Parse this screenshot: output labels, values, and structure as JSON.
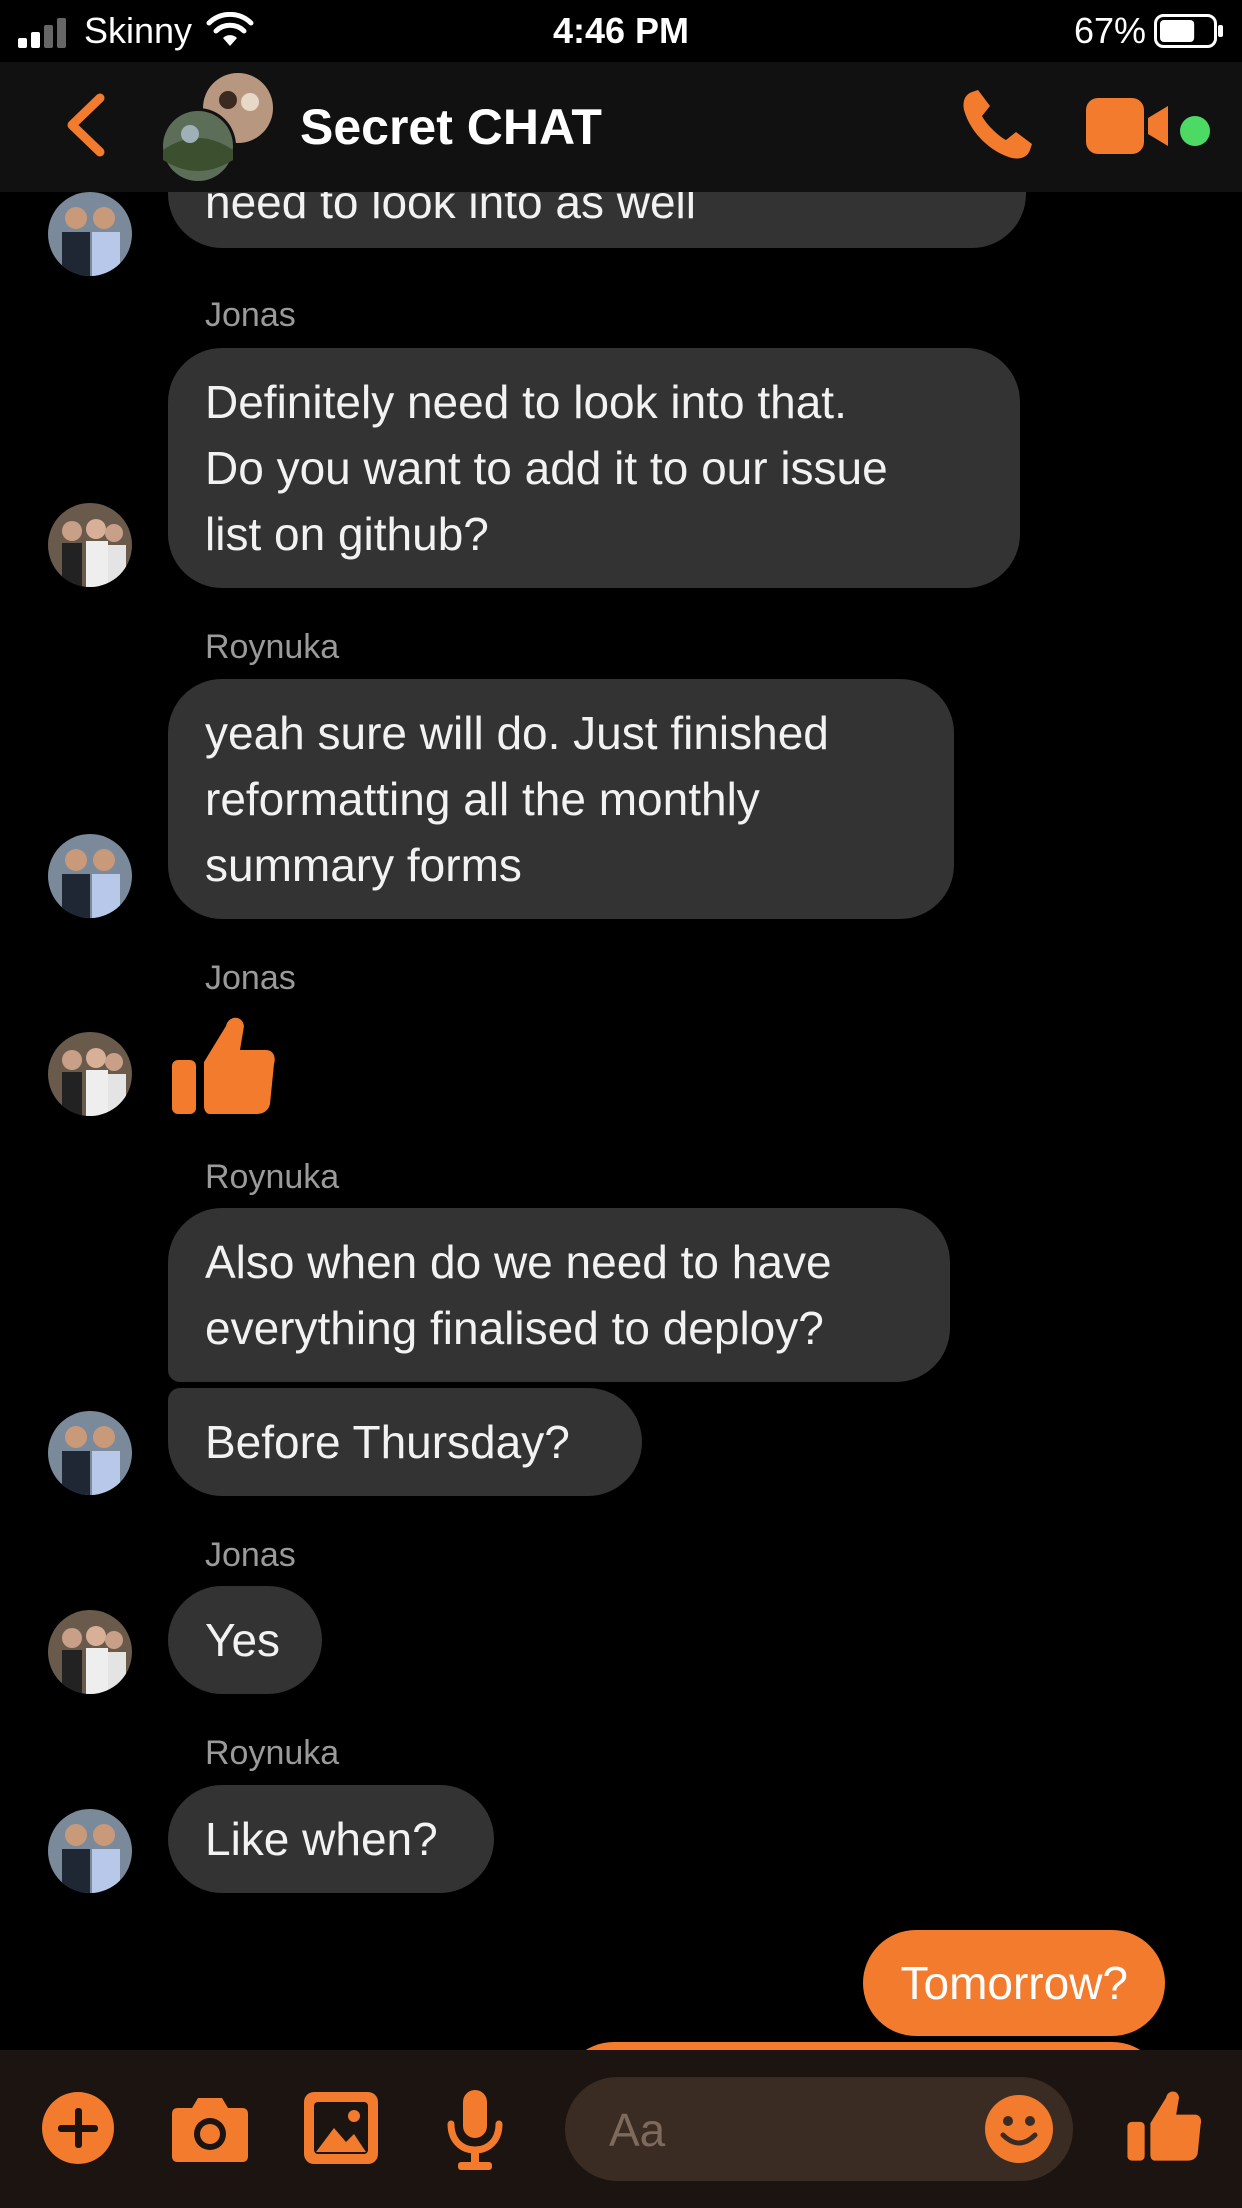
{
  "status_bar": {
    "carrier": "Skinny",
    "time": "4:46 PM",
    "battery_percent": "67%",
    "battery_level": 0.67
  },
  "header": {
    "title": "Secret CHAT",
    "back_icon": "chevron-left-icon",
    "call_icon": "phone-icon",
    "video_icon": "video-camera-icon",
    "active_indicator_color": "#4cd964"
  },
  "colors": {
    "accent": "#f27b2d",
    "incoming_bubble": "#333333",
    "background": "#000000"
  },
  "messages": [
    {
      "lines": [
        "need to look into as well"
      ]
    },
    {
      "sender": "Jonas",
      "lines": [
        "Definitely need to look into that.",
        "Do you want to add it to our issue",
        "list on github?"
      ]
    },
    {
      "sender": "Roynuka",
      "lines": [
        "yeah sure will do. Just finished",
        "reformatting all the monthly",
        "summary forms"
      ]
    },
    {
      "sender": "Jonas",
      "icon": "thumbs-up-icon"
    },
    {
      "sender": "Roynuka",
      "lines": [
        "Also when do we need to have",
        "everything finalised to deploy?"
      ]
    },
    {
      "lines": [
        "Before Thursday?"
      ]
    },
    {
      "sender": "Jonas",
      "lines": [
        "Yes"
      ]
    },
    {
      "sender": "Roynuka",
      "lines": [
        "Like when?"
      ]
    },
    {
      "outgoing": true,
      "lines": [
        "Tomorrow?"
      ]
    }
  ],
  "composer": {
    "placeholder": "Aa",
    "buttons": [
      "plus-icon",
      "camera-icon",
      "image-icon",
      "microphone-icon",
      "emoji-icon",
      "thumbs-up-icon"
    ]
  }
}
